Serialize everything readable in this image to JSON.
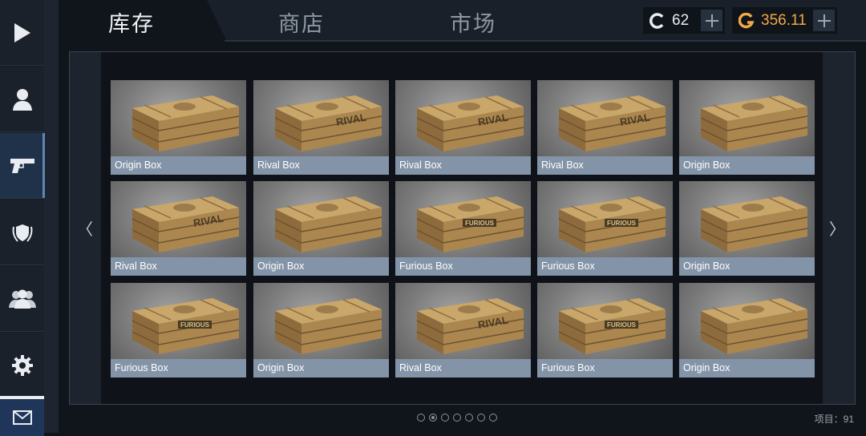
{
  "sidebar": {
    "items": [
      {
        "icon": "play-icon"
      },
      {
        "icon": "user-icon"
      },
      {
        "icon": "pistol-icon",
        "active": true
      },
      {
        "icon": "shield-laurel-icon"
      },
      {
        "icon": "friends-icon"
      },
      {
        "icon": "gear-icon"
      },
      {
        "icon": "mail-icon"
      }
    ]
  },
  "tabs": {
    "inventory": "库存",
    "shop": "商店",
    "market": "市场"
  },
  "currency": {
    "coins_value": "62",
    "gold_value": "356.11",
    "coins_icon": "coin-c-icon",
    "gold_icon": "gold-g-icon",
    "gold_color": "#f0a94a"
  },
  "inventory": {
    "items": [
      {
        "name": "Origin Box",
        "mark": ""
      },
      {
        "name": "Rival Box",
        "mark": "RIVAL"
      },
      {
        "name": "Rival Box",
        "mark": "RIVAL"
      },
      {
        "name": "Rival Box",
        "mark": "RIVAL"
      },
      {
        "name": "Origin Box",
        "mark": ""
      },
      {
        "name": "Rival Box",
        "mark": "RIVAL"
      },
      {
        "name": "Origin Box",
        "mark": ""
      },
      {
        "name": "Furious Box",
        "mark": "FURIOUS"
      },
      {
        "name": "Furious Box",
        "mark": "FURIOUS"
      },
      {
        "name": "Origin Box",
        "mark": ""
      },
      {
        "name": "Furious Box",
        "mark": "FURIOUS"
      },
      {
        "name": "Origin Box",
        "mark": ""
      },
      {
        "name": "Rival Box",
        "mark": "RIVAL"
      },
      {
        "name": "Furious Box",
        "mark": "FURIOUS"
      },
      {
        "name": "Origin Box",
        "mark": ""
      }
    ],
    "prev_arrow": "〈",
    "next_arrow": "〉"
  },
  "pagination": {
    "pages": 7,
    "current": 2
  },
  "footer": {
    "item_count": "项目：91"
  }
}
